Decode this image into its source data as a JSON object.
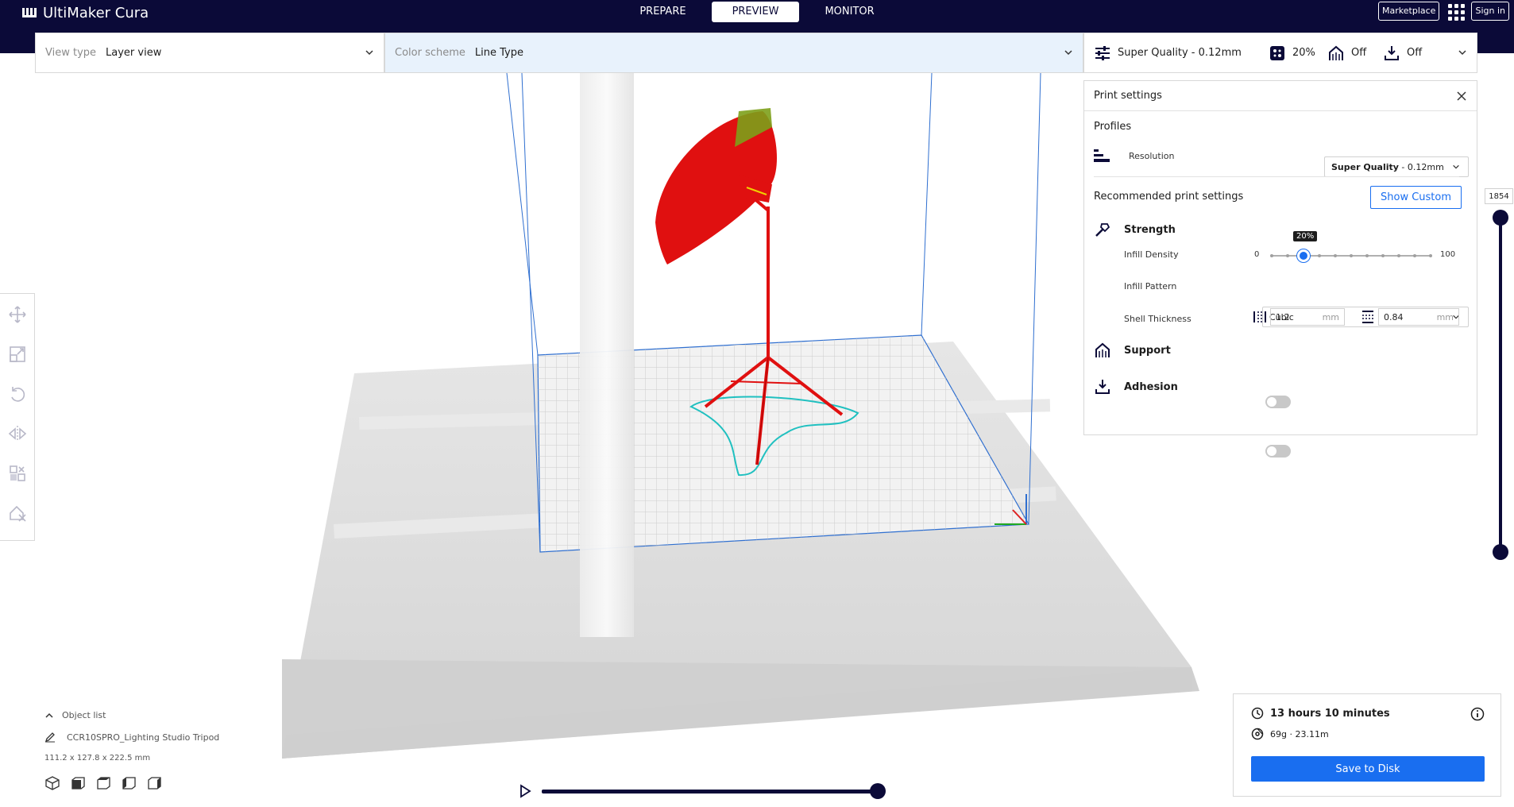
{
  "app": {
    "title": "UltiMaker Cura"
  },
  "stages": [
    "PREPARE",
    "PREVIEW",
    "MONITOR"
  ],
  "top_right": {
    "marketplace": "Marketplace",
    "signin": "Sign in"
  },
  "view_type": {
    "label": "View type",
    "value": "Layer view"
  },
  "color_scheme": {
    "label": "Color scheme",
    "value": "Line Type"
  },
  "quality_bar": {
    "profile": "Super Quality - 0.12mm",
    "infill": "20%",
    "support": "Off",
    "adhesion": "Off"
  },
  "print_settings": {
    "title": "Print settings",
    "profiles_label": "Profiles",
    "resolution_label": "Resolution",
    "resolution_value_bold": "Super Quality",
    "resolution_value_rest": " - 0.12mm",
    "recommended_label": "Recommended print settings",
    "show_custom": "Show Custom",
    "strength": "Strength",
    "infill_density_label": "Infill Density",
    "infill_min": "0",
    "infill_max": "100",
    "infill_value": "20%",
    "infill_fraction": 0.2,
    "infill_pattern_label": "Infill Pattern",
    "infill_pattern": "Cubic",
    "shell_label": "Shell Thickness",
    "wall_thickness": "1.2",
    "top_bottom_thickness": "0.84",
    "unit": "mm",
    "support": "Support",
    "adhesion": "Adhesion",
    "support_enabled": false,
    "adhesion_enabled": false
  },
  "layer_slider": {
    "current": "1854"
  },
  "object_list": {
    "label": "Object list",
    "object_name": "CCR10SPRO_Lighting Studio Tripod",
    "dimensions": "111.2 x 127.8 x 222.5 mm"
  },
  "job": {
    "time": "13 hours 10 minutes",
    "material": "69g · 23.11m",
    "save": "Save to Disk"
  },
  "colors": {
    "navy": "#0b0a38",
    "accent": "#196ef0",
    "model": "#e01010",
    "skirt": "#20c0c0"
  }
}
